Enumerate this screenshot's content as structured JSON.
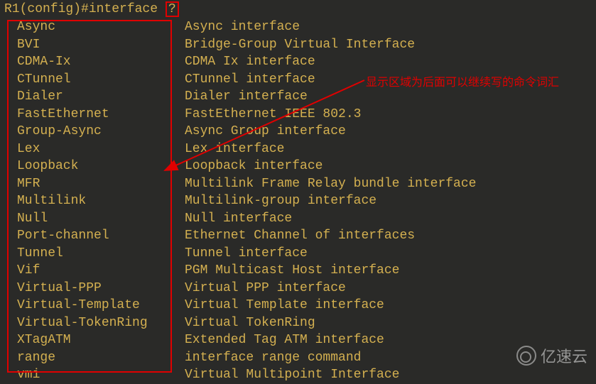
{
  "prompt": {
    "text": "R1(config)#interface ",
    "help_char": "?"
  },
  "annotation": "显示区域为后面可以继续写的命令词汇",
  "interfaces": [
    {
      "name": "Async",
      "desc": "Async interface"
    },
    {
      "name": "BVI",
      "desc": "Bridge-Group Virtual Interface"
    },
    {
      "name": "CDMA-Ix",
      "desc": "CDMA Ix interface"
    },
    {
      "name": "CTunnel",
      "desc": "CTunnel interface"
    },
    {
      "name": "Dialer",
      "desc": "Dialer interface"
    },
    {
      "name": "FastEthernet",
      "desc": "FastEthernet IEEE 802.3"
    },
    {
      "name": "Group-Async",
      "desc": "Async Group interface"
    },
    {
      "name": "Lex",
      "desc": "Lex interface"
    },
    {
      "name": "Loopback",
      "desc": "Loopback interface"
    },
    {
      "name": "MFR",
      "desc": "Multilink Frame Relay bundle interface"
    },
    {
      "name": "Multilink",
      "desc": "Multilink-group interface"
    },
    {
      "name": "Null",
      "desc": "Null interface"
    },
    {
      "name": "Port-channel",
      "desc": "Ethernet Channel of interfaces"
    },
    {
      "name": "Tunnel",
      "desc": "Tunnel interface"
    },
    {
      "name": "Vif",
      "desc": "PGM Multicast Host interface"
    },
    {
      "name": "Virtual-PPP",
      "desc": "Virtual PPP interface"
    },
    {
      "name": "Virtual-Template",
      "desc": "Virtual Template interface"
    },
    {
      "name": "Virtual-TokenRing",
      "desc": "Virtual TokenRing"
    },
    {
      "name": "XTagATM",
      "desc": "Extended Tag ATM interface"
    },
    {
      "name": "range",
      "desc": "interface range command"
    },
    {
      "name": "vmi",
      "desc": "Virtual Multipoint Interface"
    }
  ],
  "watermark": "亿速云"
}
